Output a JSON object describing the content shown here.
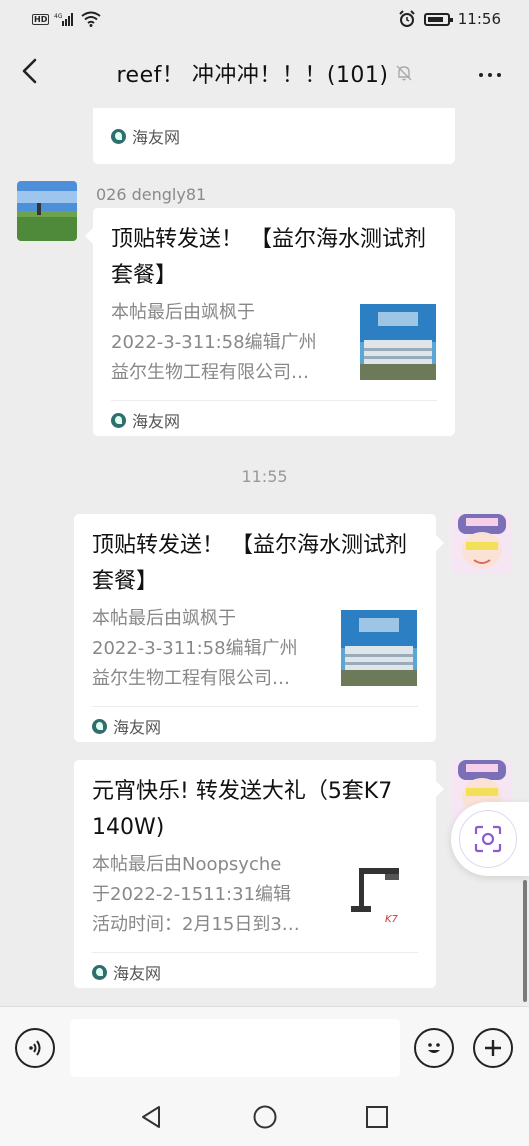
{
  "status_bar": {
    "left_badges": "HD 4G",
    "time": "11:56"
  },
  "header": {
    "title": "reef！ 冲冲冲！！！(101)"
  },
  "messages": {
    "partial_card": {
      "source": "海友网"
    },
    "msg1": {
      "sender": "026 dengly81",
      "title": "顶贴转发送！ 【益尔海水测试剂套餐】",
      "desc_lines": [
        "本帖最后由飒枫于",
        "2022-3-311:58编辑广州",
        "益尔生物工程有限公司…"
      ],
      "source": "海友网"
    },
    "timestamp": "11:55",
    "msg2": {
      "title": "顶贴转发送！ 【益尔海水测试剂套餐】",
      "desc_lines": [
        "本帖最后由飒枫于",
        "2022-3-311:58编辑广州",
        "益尔生物工程有限公司…"
      ],
      "source": "海友网"
    },
    "msg3": {
      "title": "元宵快乐! 转发送大礼（5套K7  140W)",
      "desc_lines": [
        "本帖最后由Noopsyche",
        "于2022-2-1511:31编辑",
        "活动时间：2月15日到3…"
      ],
      "source": "海友网"
    }
  },
  "input": {
    "placeholder": ""
  },
  "colors": {
    "background": "#ededed",
    "card": "#ffffff",
    "source_icon": "#2f6e6c"
  }
}
